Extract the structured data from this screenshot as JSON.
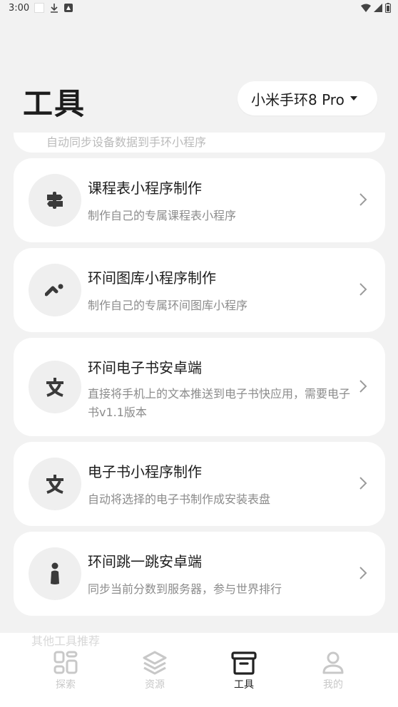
{
  "status_bar": {
    "time": "3:00"
  },
  "header": {
    "title": "工具"
  },
  "device_selector": {
    "label": "小米手环8 Pro"
  },
  "partial_card": {
    "desc": "自动同步设备数据到手环小程序"
  },
  "tools": [
    {
      "title": "课程表小程序制作",
      "desc": "制作自己的专属课程表小程序",
      "icon": "signpost-icon"
    },
    {
      "title": "环间图库小程序制作",
      "desc": "制作自己的专属环间图库小程序",
      "icon": "brush-icon"
    },
    {
      "title": "环间电子书安卓端",
      "desc": "直接将手机上的文本推送到电子书快应用，需要电子书v1.1版本",
      "icon": "text-icon"
    },
    {
      "title": "电子书小程序制作",
      "desc": "自动将选择的电子书制作成安装表盘",
      "icon": "text-icon"
    },
    {
      "title": "环间跳一跳安卓端",
      "desc": "同步当前分数到服务器，参与世界排行",
      "icon": "pawn-icon"
    }
  ],
  "section_hint": "其他工具推荐",
  "bottom_nav": [
    {
      "label": "探索",
      "icon": "grid-icon",
      "active": false
    },
    {
      "label": "资源",
      "icon": "layers-icon",
      "active": false
    },
    {
      "label": "工具",
      "icon": "archive-icon",
      "active": true
    },
    {
      "label": "我的",
      "icon": "person-icon",
      "active": false
    }
  ]
}
